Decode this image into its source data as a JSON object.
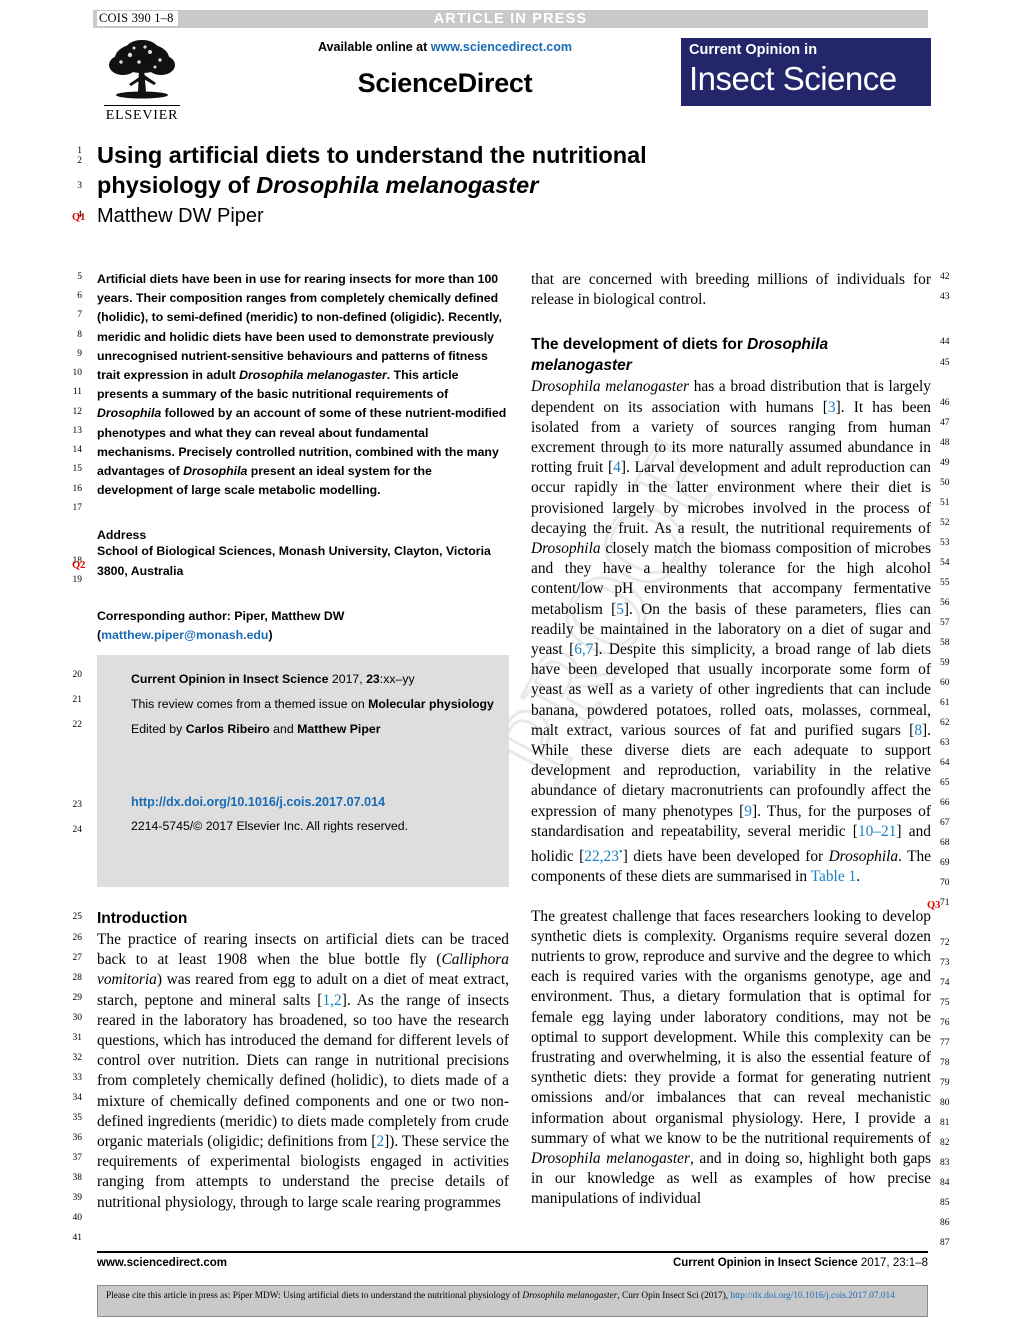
{
  "runhead": {
    "cois_code": "COIS 390 1–8",
    "status": "ARTICLE IN PRESS"
  },
  "publisher": {
    "elsevier_name": "ELSEVIER",
    "available_prefix": "Available online at ",
    "available_url": "www.sciencedirect.com",
    "sciencedirect": "ScienceDirect"
  },
  "journal_logo": {
    "line1": "Current Opinion in",
    "line2": "Insect Science",
    "bg_color": "#23266b"
  },
  "article": {
    "title_line1": "Using artificial diets to understand the nutritional",
    "title_line2_plain": "physiology of ",
    "title_line2_italic": "Drosophila melanogaster",
    "author": "Matthew DW Piper",
    "query_author": "Q1"
  },
  "abstract": {
    "text": "Artificial diets have been in use for rearing insects for more than 100 years. Their composition ranges from completely chemically defined (holidic), to semi-defined (meridic) to non-defined (oligidic). Recently, meridic and holidic diets have been used to demonstrate previously unrecognised nutrient-sensitive behaviours and patterns of fitness trait expression in adult ",
    "italic1": "Drosophila melanogaster",
    "text2": ". This article presents a summary of the basic nutritional requirements of ",
    "italic2": "Drosophila",
    "text3": " followed by an account of some of these nutrient-modified phenotypes and what they can reveal about fundamental mechanisms. Precisely controlled nutrition, combined with the many advantages of ",
    "italic3": "Drosophila",
    "text4": " present an ideal system for the development of large scale metabolic modelling."
  },
  "address": {
    "heading": "Address",
    "query": "Q2",
    "body": "School of Biological Sciences, Monash University, Clayton, Victoria 3800, Australia",
    "corresponding_prefix": "Corresponding author: Piper, Matthew DW (",
    "corresponding_email": "matthew.piper@monash.edu",
    "corresponding_suffix": ")"
  },
  "infobox": {
    "journal_bold": "Current Opinion in Insect Science",
    "journal_rest": " 2017, ",
    "volume_bold": "23",
    "pages": ":xx–yy",
    "themed_prefix": "This review comes from a themed issue on ",
    "themed_bold": "Molecular physiology",
    "edited_prefix": "Edited by ",
    "editor1": "Carlos Ribeiro",
    "edited_and": " and ",
    "editor2": "Matthew Piper",
    "doi": "http://dx.doi.org/10.1016/j.cois.2017.07.014",
    "copyright": "2214-5745/© 2017 Elsevier Inc. All rights reserved."
  },
  "introduction": {
    "heading": "Introduction",
    "p1_a": "The practice of rearing insects on artificial diets can be traced back to at least 1908 when the blue bottle fly (",
    "p1_italic": "Calliphora vomitoria",
    "p1_b": ") was reared from egg to adult on a diet of meat extract, starch, peptone and mineral salts [",
    "p1_ref1": "1,2",
    "p1_c": "]. As the range of insects reared in the laboratory has broadened, so too have the research questions, which has introduced the demand for different levels of control over nutrition. Diets can range in nutritional precisions from completely chemically defined (holidic), to diets made of a mixture of chemically defined components and one or two non-defined ingredients (meridic) to diets made completely from crude organic materials (oligidic; definitions from [",
    "p1_ref2": "2",
    "p1_d": "]). These service the requirements of experimental biologists engaged in activities ranging from attempts to understand the precise details of nutritional physiology, through to large scale rearing programmes"
  },
  "right_column": {
    "carryover": "that are concerned with breeding millions of individuals for release in biological control.",
    "section_head_plain": "The development of diets for ",
    "section_head_italic": "Drosophila melanogaster",
    "p1_italic_open": "Drosophila melanogaster",
    "p1_a": " has a broad distribution that is largely dependent on its association with humans [",
    "p1_ref1": "3",
    "p1_b": "]. It has been isolated from a variety of sources ranging from human excrement through to its more naturally assumed abundance in rotting fruit [",
    "p1_ref2": "4",
    "p1_c": "]. Larval development and adult reproduction can occur rapidly in the latter environment where their diet is provisioned largely by microbes involved in the process of decaying the fruit. As a result, the nutritional requirements of ",
    "p1_italic2": "Drosophila",
    "p1_d": " closely match the biomass composition of microbes and they have a healthy tolerance for the high alcohol content/low pH environments that accompany fermentative metabolism [",
    "p1_ref3": "5",
    "p1_e": "]. On the basis of these parameters, flies can readily be maintained in the laboratory on a diet of sugar and yeast [",
    "p1_ref4": "6,7",
    "p1_f": "]. Despite this simplicity, a broad range of lab diets have been developed that usually incorporate some form of yeast as well as a variety of other ingredients that can include banana, powdered potatoes, rolled oats, molasses, cornmeal, malt extract, various sources of fat and purified sugars [",
    "p1_ref5": "8",
    "p1_g": "]. While these diverse diets are each adequate to support development and reproduction, variability in the relative abundance of dietary macronutrients can profoundly affect the expression of many phenotypes [",
    "p1_ref6": "9",
    "p1_h": "]. Thus, for the purposes of standardisation and repeatability, several meridic [",
    "p1_ref7": "10–21",
    "p1_i": "] and holidic [",
    "p1_ref8": "22,23",
    "p1_ref8_star": "•",
    "p1_j": "] diets have been developed for ",
    "p1_italic3": "Drosophila",
    "p1_k": ". The components of these diets are summarised in ",
    "p1_tableref": "Table 1",
    "p1_l": ".",
    "query_table": "Q3",
    "p2_a": "The greatest challenge that faces researchers looking to develop synthetic diets is complexity. Organisms require several dozen nutrients to grow, reproduce and survive and the degree to which each is required varies with the organisms genotype, age and environment. Thus, a dietary formulation that is optimal for female egg laying under laboratory conditions, may not be optimal to support development. While this complexity can be frustrating and overwhelming, it is also the essential feature of synthetic diets: they provide a format for generating nutrient omissions and/or imbalances that can reveal mechanistic information about organismal physiology. Here, I provide a summary of what we know to be the nutritional requirements of ",
    "p2_italic": "Drosophila melanogaster",
    "p2_b": ", and in doing so, highlight both gaps in our knowledge as well as examples of how precise manipulations of individual"
  },
  "line_numbers": {
    "left": [
      "1",
      "2",
      "3",
      "4",
      "5",
      "6",
      "7",
      "8",
      "9",
      "10",
      "11",
      "12",
      "13",
      "14",
      "15",
      "16",
      "17",
      "18",
      "19",
      "20",
      "21",
      "22",
      "23",
      "24",
      "25",
      "26",
      "27",
      "28",
      "29",
      "30",
      "31",
      "32",
      "33",
      "34",
      "35",
      "36",
      "37",
      "38",
      "39",
      "40",
      "41"
    ],
    "right": [
      "42",
      "43",
      "44",
      "45",
      "46",
      "47",
      "48",
      "49",
      "50",
      "51",
      "52",
      "53",
      "54",
      "55",
      "56",
      "57",
      "58",
      "59",
      "60",
      "61",
      "62",
      "63",
      "64",
      "65",
      "66",
      "67",
      "68",
      "69",
      "70",
      "71",
      "72",
      "73",
      "74",
      "75",
      "76",
      "77",
      "78",
      "79",
      "80",
      "81",
      "82",
      "83",
      "84",
      "85",
      "86",
      "87"
    ]
  },
  "footer": {
    "left": "www.sciencedirect.com",
    "right_bold": "Current Opinion in Insect Science",
    "right_rest": " 2017, 23:1–8",
    "cite_prefix": "Please cite this article in press as: Piper MDW: Using artificial diets to understand the nutritional physiology of ",
    "cite_italic": "Drosophila melanogaster",
    "cite_middle": ", Curr Opin Insect Sci (2017), ",
    "cite_link": "http://dx.doi.org/10.1016/j.cois.2017.07.014"
  }
}
